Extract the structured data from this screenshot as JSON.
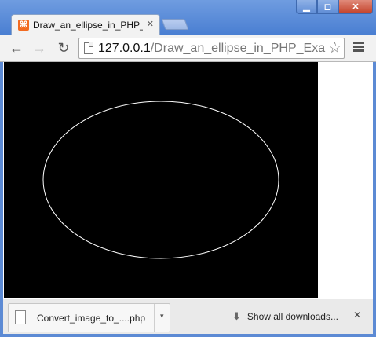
{
  "browser": {
    "tab": {
      "favicon_glyph": "⌘",
      "title": "Draw_an_ellipse_in_PHP_E",
      "close_glyph": "✕"
    },
    "window_controls": {
      "minimize_glyph": "▁",
      "maximize_glyph": "◻",
      "close_glyph": "✕"
    },
    "toolbar": {
      "back_glyph": "←",
      "forward_glyph": "→",
      "reload_glyph": "↻",
      "star_glyph": "☆"
    },
    "omnibox": {
      "host": "127.0.0.1",
      "path": "/Draw_an_ellipse_in_PHP_Examp"
    }
  },
  "page": {
    "canvas_background": "#000000",
    "ellipse_stroke": "#ffffff"
  },
  "downloads": {
    "item_filename": "Convert_image_to_....php",
    "item_menu_glyph": "▾",
    "show_all_icon_glyph": "⬇",
    "show_all_label": "Show all downloads...",
    "close_glyph": "✕"
  },
  "colors": {
    "frame": "#5a8cd8",
    "toolbar": "#f2f2f2",
    "shelf": "#eaeaea"
  }
}
